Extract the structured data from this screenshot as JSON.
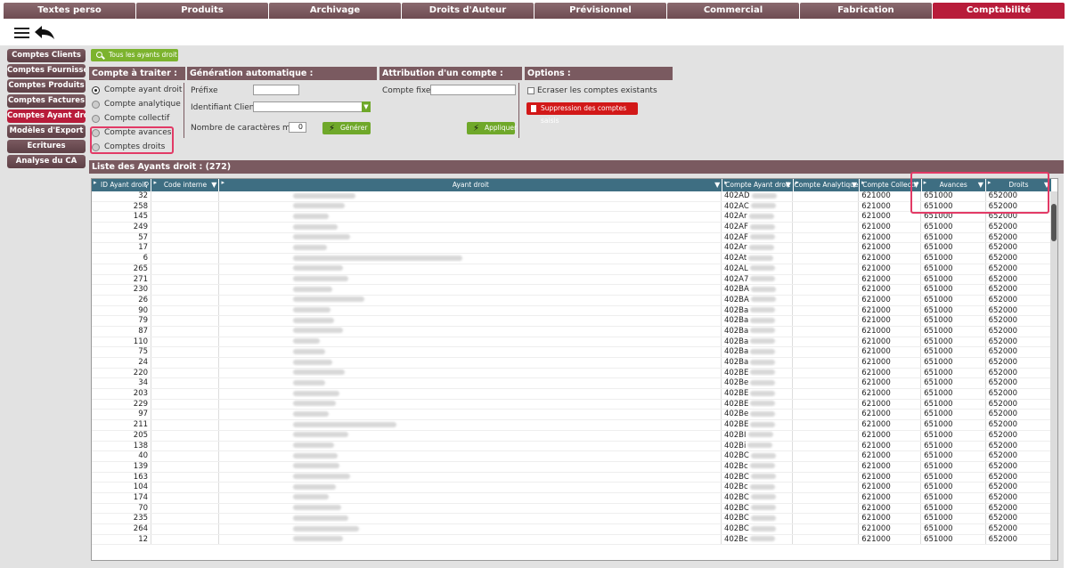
{
  "top_tabs": [
    "Textes perso",
    "Produits",
    "Archivage",
    "Droits d'Auteur",
    "Prévisionnel",
    "Commercial",
    "Fabrication",
    "Comptabilité"
  ],
  "active_tab": "Comptabilité",
  "sidebar": [
    "Comptes Clients",
    "Comptes Fournisseurs",
    "Comptes Produits",
    "Comptes Factures",
    "Comptes Ayant droits",
    "Modèles d'Export",
    "Ecritures",
    "Analyse du CA"
  ],
  "sidebar_active": "Comptes Ayant droits",
  "filter_button": "Tous les ayants droit",
  "compte_panel": {
    "title": "Compte à traiter :",
    "options": [
      "Compte ayant droit",
      "Compte analytique",
      "Compte collectif",
      "Compte avances",
      "Comptes droits"
    ],
    "selected": "Compte ayant droit"
  },
  "generation_panel": {
    "title": "Génération automatique :",
    "prefix_label": "Préfixe",
    "prefix_value": "",
    "client_id_label": "Identifiant Client",
    "client_id_value": "",
    "max_chars_label": "Nombre de caractères maxi",
    "max_chars_value": "0",
    "generate_button": "Générer"
  },
  "attribution_panel": {
    "title": "Attribution d'un compte :",
    "fixed_label": "Compte fixe",
    "fixed_value": "",
    "apply_button": "Appliquer"
  },
  "options_panel": {
    "title": "Options :",
    "overwrite_label": "Ecraser les comptes existants",
    "overwrite_checked": false,
    "delete_button": "Suppression des comptes saisis"
  },
  "list_title": "Liste des Ayants droit : (272)",
  "columns": [
    "ID Ayant droit",
    "Code interne",
    "Ayant droit",
    "Compte Ayant droit",
    "Compte Analytique",
    "Compte Collectif",
    "Avances",
    "Droits"
  ],
  "rows": [
    {
      "id": "32",
      "compte": "402AD",
      "collectif": "621000",
      "avances": "651000",
      "droits": "652000"
    },
    {
      "id": "258",
      "compte": "402AC",
      "collectif": "621000",
      "avances": "651000",
      "droits": "652000"
    },
    {
      "id": "145",
      "compte": "402Ar",
      "collectif": "621000",
      "avances": "651000",
      "droits": "652000"
    },
    {
      "id": "249",
      "compte": "402AF",
      "collectif": "621000",
      "avances": "651000",
      "droits": "652000"
    },
    {
      "id": "57",
      "compte": "402AF",
      "collectif": "621000",
      "avances": "651000",
      "droits": "652000"
    },
    {
      "id": "17",
      "compte": "402Ar",
      "collectif": "621000",
      "avances": "651000",
      "droits": "652000"
    },
    {
      "id": "6",
      "compte": "402At",
      "collectif": "621000",
      "avances": "651000",
      "droits": "652000"
    },
    {
      "id": "265",
      "compte": "402AL",
      "collectif": "621000",
      "avances": "651000",
      "droits": "652000"
    },
    {
      "id": "271",
      "compte": "402A7",
      "collectif": "621000",
      "avances": "651000",
      "droits": "652000"
    },
    {
      "id": "230",
      "compte": "402BA",
      "collectif": "621000",
      "avances": "651000",
      "droits": "652000"
    },
    {
      "id": "26",
      "compte": "402BA",
      "collectif": "621000",
      "avances": "651000",
      "droits": "652000"
    },
    {
      "id": "90",
      "compte": "402Ba",
      "collectif": "621000",
      "avances": "651000",
      "droits": "652000"
    },
    {
      "id": "79",
      "compte": "402Ba",
      "collectif": "621000",
      "avances": "651000",
      "droits": "652000"
    },
    {
      "id": "87",
      "compte": "402Ba",
      "collectif": "621000",
      "avances": "651000",
      "droits": "652000"
    },
    {
      "id": "110",
      "compte": "402Ba",
      "collectif": "621000",
      "avances": "651000",
      "droits": "652000"
    },
    {
      "id": "75",
      "compte": "402Ba",
      "collectif": "621000",
      "avances": "651000",
      "droits": "652000"
    },
    {
      "id": "24",
      "compte": "402Ba",
      "collectif": "621000",
      "avances": "651000",
      "droits": "652000"
    },
    {
      "id": "220",
      "compte": "402BE",
      "collectif": "621000",
      "avances": "651000",
      "droits": "652000"
    },
    {
      "id": "34",
      "compte": "402Be",
      "collectif": "621000",
      "avances": "651000",
      "droits": "652000"
    },
    {
      "id": "203",
      "compte": "402BE",
      "collectif": "621000",
      "avances": "651000",
      "droits": "652000"
    },
    {
      "id": "229",
      "compte": "402BE",
      "collectif": "621000",
      "avances": "651000",
      "droits": "652000"
    },
    {
      "id": "97",
      "compte": "402Be",
      "collectif": "621000",
      "avances": "651000",
      "droits": "652000"
    },
    {
      "id": "211",
      "compte": "402BE",
      "collectif": "621000",
      "avances": "651000",
      "droits": "652000"
    },
    {
      "id": "205",
      "compte": "402BI",
      "collectif": "621000",
      "avances": "651000",
      "droits": "652000"
    },
    {
      "id": "138",
      "compte": "402Bi",
      "collectif": "621000",
      "avances": "651000",
      "droits": "652000"
    },
    {
      "id": "40",
      "compte": "402BC",
      "collectif": "621000",
      "avances": "651000",
      "droits": "652000"
    },
    {
      "id": "139",
      "compte": "402Bc",
      "collectif": "621000",
      "avances": "651000",
      "droits": "652000"
    },
    {
      "id": "163",
      "compte": "402BC",
      "collectif": "621000",
      "avances": "651000",
      "droits": "652000"
    },
    {
      "id": "104",
      "compte": "402Bc",
      "collectif": "621000",
      "avances": "651000",
      "droits": "652000"
    },
    {
      "id": "174",
      "compte": "402BC",
      "collectif": "621000",
      "avances": "651000",
      "droits": "652000"
    },
    {
      "id": "70",
      "compte": "402BC",
      "collectif": "621000",
      "avances": "651000",
      "droits": "652000"
    },
    {
      "id": "235",
      "compte": "402BC",
      "collectif": "621000",
      "avances": "651000",
      "droits": "652000"
    },
    {
      "id": "264",
      "compte": "402BC",
      "collectif": "621000",
      "avances": "651000",
      "droits": "652000"
    },
    {
      "id": "12",
      "compte": "402Bc",
      "collectif": "621000",
      "avances": "651000",
      "droits": "652000"
    }
  ],
  "colors": {
    "tab": "#6e4c52",
    "active": "#b81c3a",
    "grid_header": "#3e6e82",
    "green": "#6fa82a",
    "red": "#d21818",
    "highlight": "#e23a66"
  }
}
